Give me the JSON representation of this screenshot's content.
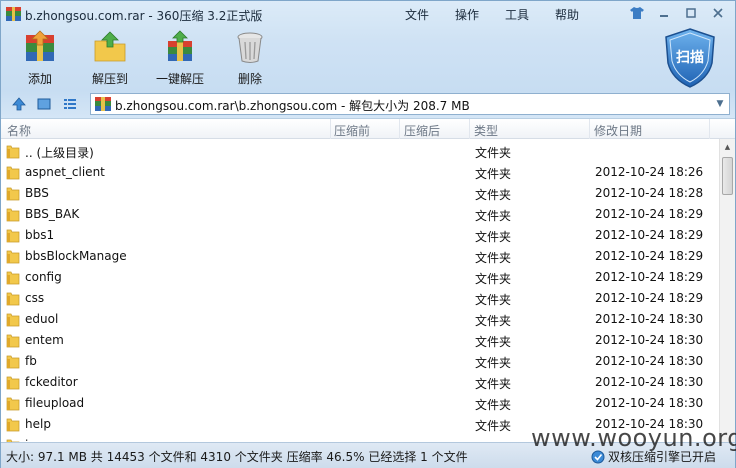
{
  "window": {
    "title": "b.zhongsou.com.rar - 360压缩 3.2正式版",
    "menus": [
      "文件",
      "操作",
      "工具",
      "帮助"
    ]
  },
  "toolbar": {
    "add_label": "添加",
    "extract_to_label": "解压到",
    "one_click_label": "一键解压",
    "delete_label": "删除",
    "scan_label": "扫描"
  },
  "address": {
    "path": "b.zhongsou.com.rar\\b.zhongsou.com - 解包大小为 208.7 MB"
  },
  "columns": {
    "name": "名称",
    "compressed": "压缩前",
    "after": "压缩后",
    "type": "类型",
    "modified": "修改日期"
  },
  "files": [
    {
      "name": ".. (上级目录)",
      "type": "文件夹",
      "date": ""
    },
    {
      "name": "aspnet_client",
      "type": "文件夹",
      "date": "2012-10-24 18:26"
    },
    {
      "name": "BBS",
      "type": "文件夹",
      "date": "2012-10-24 18:28"
    },
    {
      "name": "BBS_BAK",
      "type": "文件夹",
      "date": "2012-10-24 18:29"
    },
    {
      "name": "bbs1",
      "type": "文件夹",
      "date": "2012-10-24 18:29"
    },
    {
      "name": "bbsBlockManage",
      "type": "文件夹",
      "date": "2012-10-24 18:29"
    },
    {
      "name": "config",
      "type": "文件夹",
      "date": "2012-10-24 18:29"
    },
    {
      "name": "css",
      "type": "文件夹",
      "date": "2012-10-24 18:29"
    },
    {
      "name": "eduol",
      "type": "文件夹",
      "date": "2012-10-24 18:30"
    },
    {
      "name": "entem",
      "type": "文件夹",
      "date": "2012-10-24 18:30"
    },
    {
      "name": "fb",
      "type": "文件夹",
      "date": "2012-10-24 18:30"
    },
    {
      "name": "fckeditor",
      "type": "文件夹",
      "date": "2012-10-24 18:30"
    },
    {
      "name": "fileupload",
      "type": "文件夹",
      "date": "2012-10-24 18:30"
    },
    {
      "name": "help",
      "type": "文件夹",
      "date": "2012-10-24 18:30"
    },
    {
      "name": "i",
      "type": "",
      "date": ""
    }
  ],
  "status": {
    "text": "大小: 97.1 MB 共 14453 个文件和 4310 个文件夹 压缩率 46.5% 已经选择 1 个文件",
    "engine": "双核压缩引擎已开启"
  },
  "watermark": "www.wooyun.org",
  "colors": {
    "accent": "#2f77c8",
    "folder": "#f2c84b"
  }
}
